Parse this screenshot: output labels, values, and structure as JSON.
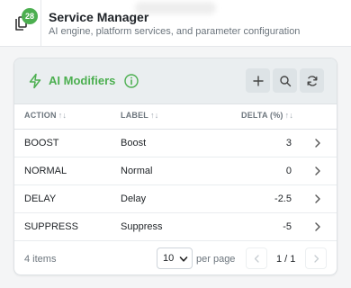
{
  "header": {
    "badge_count": "28",
    "title": "Service Manager",
    "subtitle": "AI engine, platform services, and parameter configuration"
  },
  "card": {
    "title": "AI Modifiers",
    "accent_color": "#4caf50",
    "buttons": [
      "plus-icon",
      "search-icon",
      "refresh-icon"
    ]
  },
  "table": {
    "columns": [
      "ACTION",
      "LABEL",
      "DELTA (%)"
    ],
    "rows": [
      {
        "action": "BOOST",
        "label": "Boost",
        "delta": "3"
      },
      {
        "action": "NORMAL",
        "label": "Normal",
        "delta": "0"
      },
      {
        "action": "DELAY",
        "label": "Delay",
        "delta": "-2.5"
      },
      {
        "action": "SUPPRESS",
        "label": "Suppress",
        "delta": "-5"
      }
    ]
  },
  "footer": {
    "item_count": "4 items",
    "per_page_value": "10",
    "per_page_label": "per page",
    "page_text": "1 / 1"
  }
}
